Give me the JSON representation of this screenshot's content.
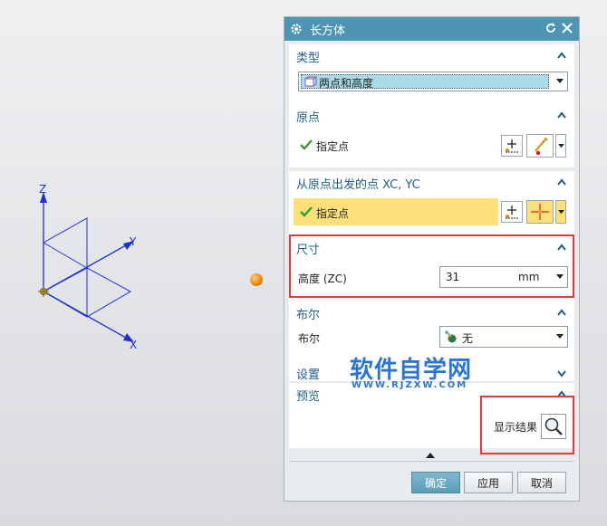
{
  "dialog": {
    "title": "长方体",
    "type_section": {
      "title": "类型",
      "selected": "两点和高度"
    },
    "origin_section": {
      "title": "原点",
      "point_label": "指定点"
    },
    "from_origin_section": {
      "title": "从原点出发的点 XC, YC",
      "point_label": "指定点"
    },
    "dimension_section": {
      "title": "尺寸",
      "height_label": "高度 (ZC)",
      "height_value": "31",
      "height_unit": "mm"
    },
    "boolean_section": {
      "title": "布尔",
      "boolean_label": "布尔",
      "boolean_value": "无"
    },
    "settings_section": {
      "title": "设置"
    },
    "preview_section": {
      "title": "预览",
      "show_result_label": "显示结果"
    },
    "buttons": {
      "ok": "确定",
      "apply": "应用",
      "cancel": "取消"
    }
  },
  "axes": {
    "x": "X",
    "y": "Y",
    "z": "Z"
  },
  "watermark": {
    "main": "软件自学网",
    "url": "WWW.RJZXW.COM"
  },
  "colors": {
    "title_bar": "#4e95b5",
    "section_title": "#1f5f8a",
    "highlight_yellow": "#fde07a",
    "annotation_red": "#e23a3a",
    "watermark_blue": "#2a74d6"
  }
}
